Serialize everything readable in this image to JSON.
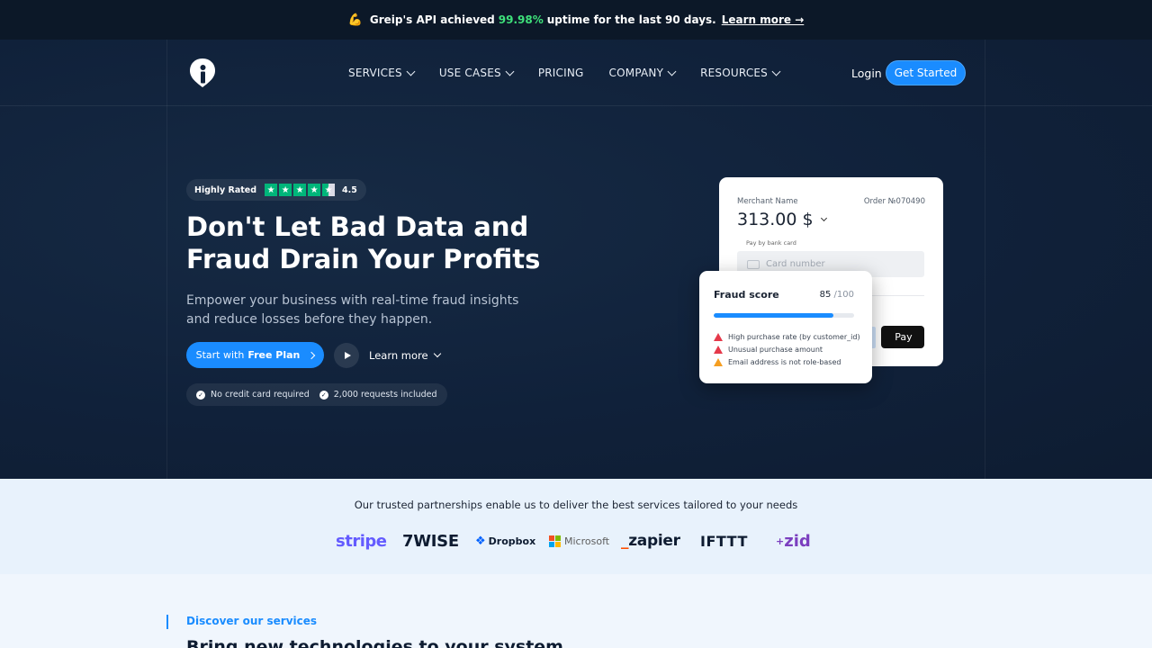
{
  "announcement": {
    "emoji": "💪",
    "prefix": "Greip's API achieved",
    "uptime": "99.98%",
    "suffix": "uptime for the last 90 days.",
    "link": "Learn more →"
  },
  "nav": {
    "items": [
      {
        "label": "SERVICES",
        "dropdown": true
      },
      {
        "label": "USE CASES",
        "dropdown": true
      },
      {
        "label": "PRICING",
        "dropdown": false
      },
      {
        "label": "COMPANY",
        "dropdown": true
      },
      {
        "label": "RESOURCES",
        "dropdown": true
      }
    ],
    "login": "Login",
    "get_started": "Get Started"
  },
  "hero": {
    "rating_label": "Highly Rated",
    "rating_value": "4.5",
    "rating_stars": 4.5,
    "headline_line1": "Don't Let Bad Data and",
    "headline_line2": "Fraud Drain Your Profits",
    "subtitle": "Empower your business with real-time fraud insights and reduce losses before they happen.",
    "cta_prefix": "Start with",
    "cta_bold": "Free Plan",
    "learn_more": "Learn more",
    "check_1": "No credit card required",
    "check_2": "2,000 requests included"
  },
  "payment_card": {
    "merchant": "Merchant Name",
    "order": "Order №070490",
    "amount": "313.00 $",
    "pay_label": "Pay by bank card",
    "card_placeholder": "Card number",
    "apple_pay": "Pay"
  },
  "fraud_card": {
    "title": "Fraud score",
    "score": "85",
    "max": "/100",
    "score_fraction": 0.85,
    "flags": [
      {
        "text": "High purchase rate (by customer_id)",
        "level": "high"
      },
      {
        "text": "Unusual purchase amount",
        "level": "high"
      },
      {
        "text": "Email address is not role-based",
        "level": "medium"
      }
    ]
  },
  "partners": {
    "tagline": "Our trusted partnerships enable us to deliver the best services tailored to your needs",
    "logos": {
      "stripe": "stripe",
      "wise": "7WISE",
      "dropbox": "Dropbox",
      "microsoft": "Microsoft",
      "zapier_prefix": "_",
      "zapier": "zapier",
      "ifttt": "IFTTT",
      "zid_prefix": "+",
      "zid": "zid"
    }
  },
  "services": {
    "eyebrow": "Discover our services",
    "heading": "Bring new technologies to your system"
  },
  "colors": {
    "accent": "#1a8cff",
    "uptime_green": "#3ee07a",
    "trustpilot_green": "#00b67a",
    "warning_red": "#e5394a",
    "warning_orange": "#f59e21"
  }
}
